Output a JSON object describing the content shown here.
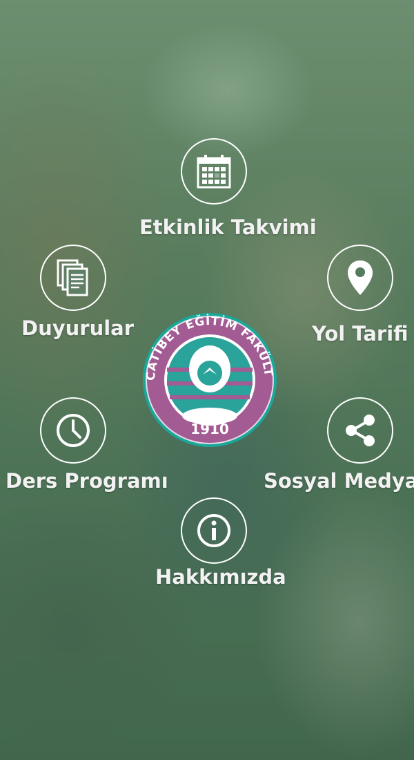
{
  "menu": {
    "items": [
      {
        "id": "etkinlik",
        "label": "Etkinlik Takvimi",
        "icon": "calendar-icon"
      },
      {
        "id": "duyurular",
        "label": "Duyurular",
        "icon": "documents-icon"
      },
      {
        "id": "yol",
        "label": "Yol Tarifi",
        "icon": "map-pin-icon"
      },
      {
        "id": "ders",
        "label": "Ders Programı",
        "icon": "clock-icon"
      },
      {
        "id": "sosyal",
        "label": "Sosyal Medya",
        "icon": "share-icon"
      },
      {
        "id": "hakkimizda",
        "label": "Hakkımızda",
        "icon": "info-icon"
      }
    ]
  },
  "logo": {
    "ring_text": "NECATİBEY EĞİTİM FAKÜLTESİ",
    "year": "1910",
    "colors": {
      "ring": "#a35b93",
      "inner": "#2aa39a",
      "outline": "#1aa79a"
    }
  },
  "colors": {
    "tint": "#2d5f3c",
    "icon_stroke": "#ffffff"
  }
}
